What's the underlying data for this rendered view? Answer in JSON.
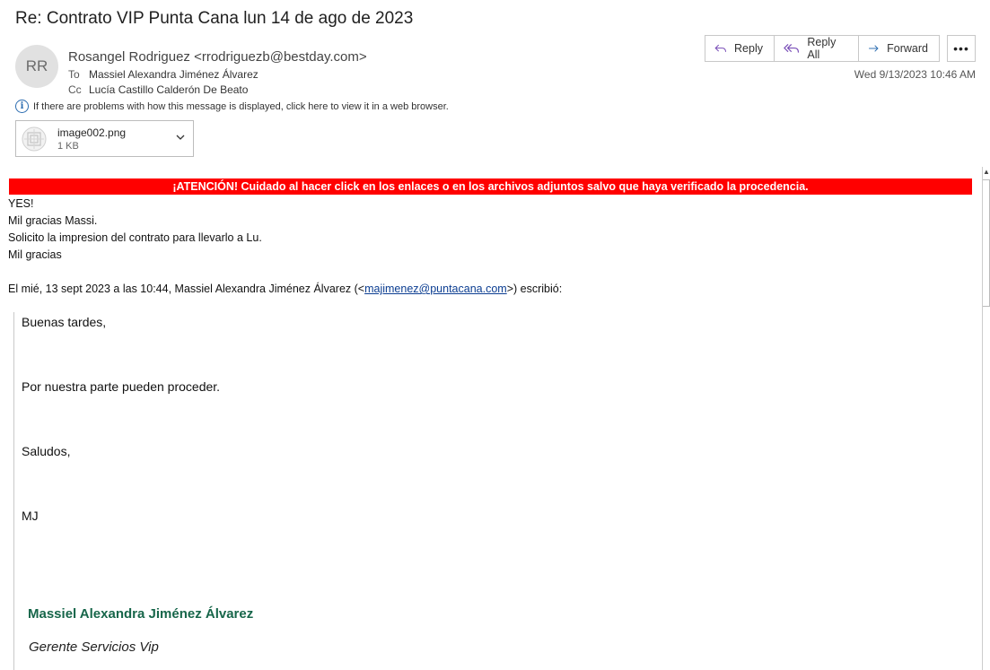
{
  "subject": "Re: Contrato VIP Punta Cana lun 14 de ago de 2023",
  "avatar_initials": "RR",
  "sender": "Rosangel Rodriguez <rrodriguezb@bestday.com>",
  "to_label": "To",
  "to_value": "Massiel Alexandra Jiménez Álvarez",
  "cc_label": "Cc",
  "cc_value": "Lucía Castillo Calderón De Beato",
  "actions": {
    "reply": "Reply",
    "reply_all": "Reply All",
    "forward": "Forward",
    "more": "•••"
  },
  "date": "Wed 9/13/2023 10:46 AM",
  "info_text": "If there are problems with how this message is displayed, click here to view it in a web browser.",
  "attachment": {
    "name": "image002.png",
    "size": "1 KB"
  },
  "banner": "¡ATENCIÓN! Cuidado al hacer click en los enlaces o en los archivos adjuntos salvo que haya verificado la procedencia.",
  "body": {
    "line1": "YES!",
    "line2": "Mil gracias Massi.",
    "line3": "Solicito la impresion del contrato para llevarlo a Lu.",
    "line4": "Mil gracias",
    "quote_intro_pre": "El mié, 13 sept 2023 a las 10:44, Massiel Alexandra Jiménez Álvarez (<",
    "quote_intro_link": "majimenez@puntacana.com",
    "quote_intro_post": ">) escribió:"
  },
  "quoted": {
    "greeting": "Buenas tardes,",
    "text": "Por nuestra parte pueden proceder.",
    "closing": "Saludos,",
    "initials": "MJ",
    "signature_name": "Massiel Alexandra Jiménez Álvarez",
    "signature_title": "Gerente Servicios Vip"
  },
  "colors": {
    "banner_bg": "#ff0000",
    "signature_name": "#17664a",
    "link": "#0b3d91"
  }
}
